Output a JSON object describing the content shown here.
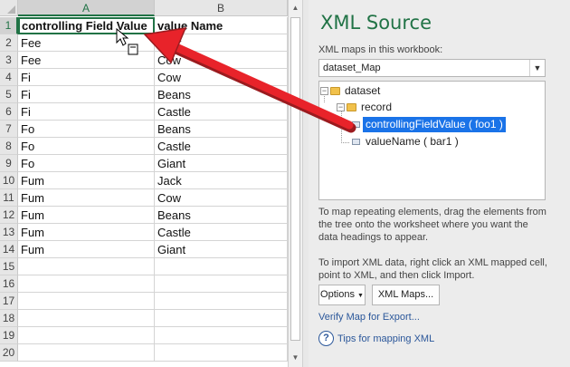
{
  "sheet": {
    "columns": [
      "A",
      "B"
    ],
    "rows": [
      {
        "num": "1",
        "a": "controlling Field Value",
        "b": "value Name"
      },
      {
        "num": "2",
        "a": "Fee",
        "b": "Jack"
      },
      {
        "num": "3",
        "a": "Fee",
        "b": "Cow"
      },
      {
        "num": "4",
        "a": "Fi",
        "b": "Cow"
      },
      {
        "num": "5",
        "a": "Fi",
        "b": "Beans"
      },
      {
        "num": "6",
        "a": "Fi",
        "b": "Castle"
      },
      {
        "num": "7",
        "a": "Fo",
        "b": "Beans"
      },
      {
        "num": "8",
        "a": "Fo",
        "b": "Castle"
      },
      {
        "num": "9",
        "a": "Fo",
        "b": "Giant"
      },
      {
        "num": "10",
        "a": "Fum",
        "b": "Jack"
      },
      {
        "num": "11",
        "a": "Fum",
        "b": "Cow"
      },
      {
        "num": "12",
        "a": "Fum",
        "b": "Beans"
      },
      {
        "num": "13",
        "a": "Fum",
        "b": "Castle"
      },
      {
        "num": "14",
        "a": "Fum",
        "b": "Giant"
      },
      {
        "num": "15",
        "a": "",
        "b": ""
      },
      {
        "num": "16",
        "a": "",
        "b": ""
      },
      {
        "num": "17",
        "a": "",
        "b": ""
      },
      {
        "num": "18",
        "a": "",
        "b": ""
      },
      {
        "num": "19",
        "a": "",
        "b": ""
      },
      {
        "num": "20",
        "a": "",
        "b": ""
      }
    ]
  },
  "pane": {
    "title": "XML Source",
    "maps_label": "XML maps in this workbook:",
    "selected_map": "dataset_Map",
    "tree": {
      "root": "dataset",
      "record": "record",
      "field1": "controllingFieldValue ( foo1 )",
      "field2": "valueName ( bar1 )"
    },
    "hint_map": "To map repeating elements, drag the elements from the tree onto the worksheet where you want the data headings to appear.",
    "hint_import": "To import XML data, right click an XML mapped cell, point to XML, and then click Import.",
    "options_button": "Options",
    "xml_maps_button": "XML Maps...",
    "verify_link": "Verify Map for Export...",
    "tips_link": "Tips for mapping XML"
  },
  "colors": {
    "excel_green": "#217346",
    "selection_blue": "#1a73e8",
    "annotation_red": "#e8232a"
  }
}
